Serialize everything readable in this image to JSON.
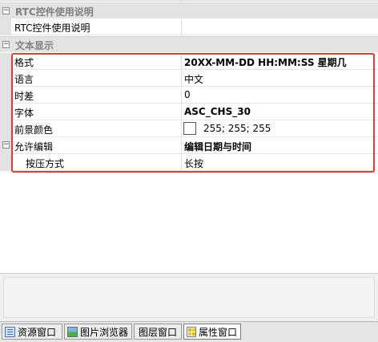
{
  "grid": {
    "category_rtc": {
      "title": "RTC控件使用说明",
      "toggle": "⊟"
    },
    "rtc_row": {
      "name": "RTC控件使用说明",
      "value": ""
    },
    "category_text": {
      "title": "文本显示",
      "toggle": "⊟"
    },
    "rows": [
      {
        "name": "格式",
        "value": "20XX-MM-DD HH:MM:SS 星期几",
        "bold": true
      },
      {
        "name": "语言",
        "value": "中文"
      },
      {
        "name": "时差",
        "value": "0"
      },
      {
        "name": "字体",
        "value": "ASC_CHS_30",
        "bold": true
      },
      {
        "name": "前景颜色",
        "value": "255; 255; 255",
        "swatch_color": "#ffffff"
      },
      {
        "name": "允许编辑",
        "value": "编辑日期与时间",
        "bold": true,
        "toggle": "⊟"
      },
      {
        "name": "按压方式",
        "value": "长按"
      }
    ]
  },
  "highlight_color": "#e53935",
  "tabs": [
    {
      "label": "资源窗口",
      "icon": "resource-window-icon"
    },
    {
      "label": "图片浏览器",
      "icon": "image-browser-icon"
    },
    {
      "label": "图层窗口",
      "icon": ""
    },
    {
      "label": "属性窗口",
      "icon": "property-window-icon",
      "active": true
    }
  ]
}
